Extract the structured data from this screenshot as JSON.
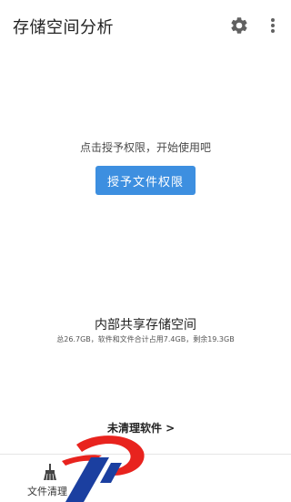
{
  "header": {
    "title": "存储空间分析",
    "settings_icon": "gear-icon",
    "more_icon": "more-vertical-icon"
  },
  "permission": {
    "hint": "点击授予权限，开始使用吧",
    "button_label": "授予文件权限",
    "button_color": "#3d8fe0"
  },
  "storage": {
    "title": "内部共享存储空间",
    "summary": "总26.7GB，软件和文件合计占用7.4GB，剩余19.3GB"
  },
  "junk": {
    "label": "未清理软件 >"
  },
  "bottom_nav": {
    "items": [
      {
        "label": "文件清理",
        "icon": "broom-icon"
      }
    ]
  },
  "watermark": {
    "icon": "logo-watermark",
    "colors": [
      "#e8231e",
      "#1b3fa0"
    ]
  }
}
